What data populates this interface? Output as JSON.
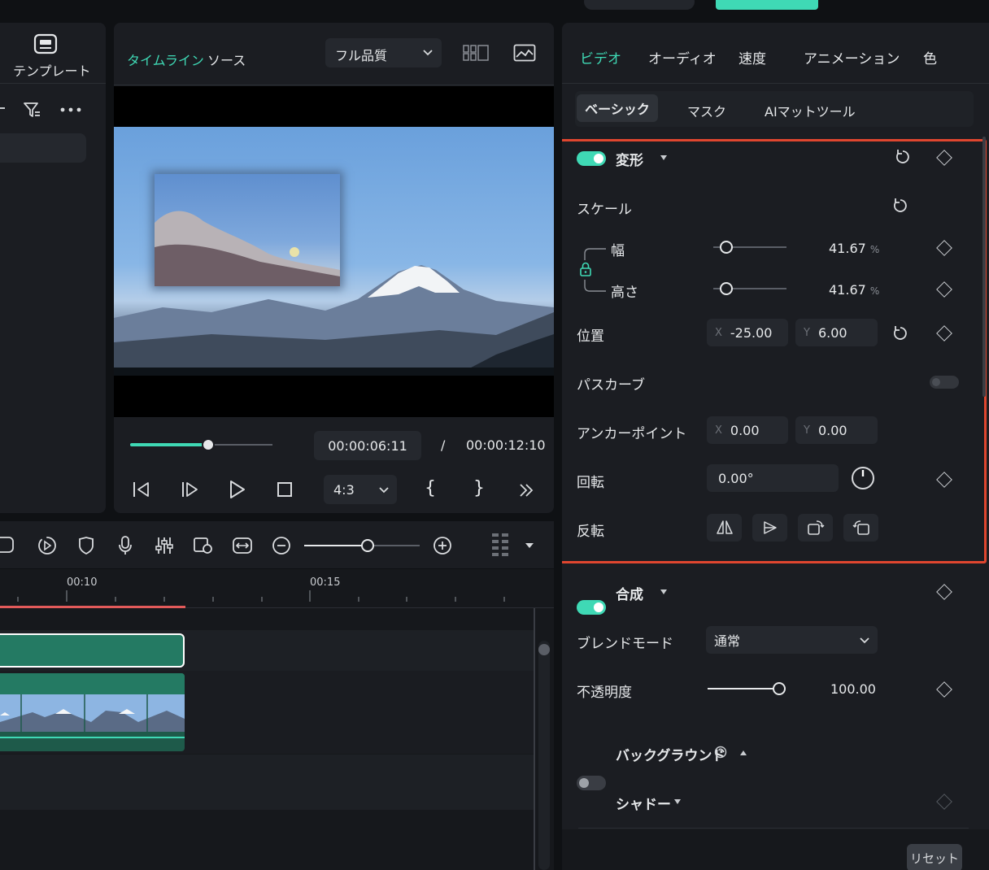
{
  "left_panel": {
    "template_label": "テンプレート"
  },
  "preview": {
    "tab_timeline": "タイムライン",
    "tab_source": "ソース",
    "quality": "フル品質",
    "progress": 0.55,
    "current_time": "00:00:06:11",
    "separator": "/",
    "total_time": "00:00:12:10",
    "aspect": "4:3",
    "mark_in": "{",
    "mark_out": "}"
  },
  "timeline": {
    "ruler_labels": [
      "00:10",
      "00:15"
    ],
    "zoom": 0.55
  },
  "inspector": {
    "tabs": [
      "ビデオ",
      "オーディオ",
      "速度",
      "アニメーション",
      "色"
    ],
    "subtabs": [
      "ベーシック",
      "マスク",
      "AIマットツール"
    ],
    "transform": {
      "title": "変形",
      "scale_label": "スケール",
      "width_label": "幅",
      "width_value": "41.67",
      "height_label": "高さ",
      "height_value": "41.67",
      "unit": "%",
      "position_label": "位置",
      "pos_x_prefix": "X",
      "pos_x": "-25.00",
      "pos_y_prefix": "Y",
      "pos_y": "6.00",
      "path_curve_label": "パスカーブ",
      "anchor_label": "アンカーポイント",
      "anchor_x_prefix": "X",
      "anchor_x": "0.00",
      "anchor_y_prefix": "Y",
      "anchor_y": "0.00",
      "rotate_label": "回転",
      "rotate_value": "0.00°",
      "flip_label": "反転"
    },
    "composite": {
      "title": "合成",
      "blend_label": "ブレンドモード",
      "blend_value": "通常",
      "opacity_label": "不透明度",
      "opacity_value": "100.00",
      "opacity_level": 1.0
    },
    "background_title": "バックグラウンド",
    "shadow_title": "シャドー",
    "reset_label": "リセット"
  },
  "colors": {
    "accent": "#3fd9b5",
    "highlight_border": "#e0462f"
  }
}
